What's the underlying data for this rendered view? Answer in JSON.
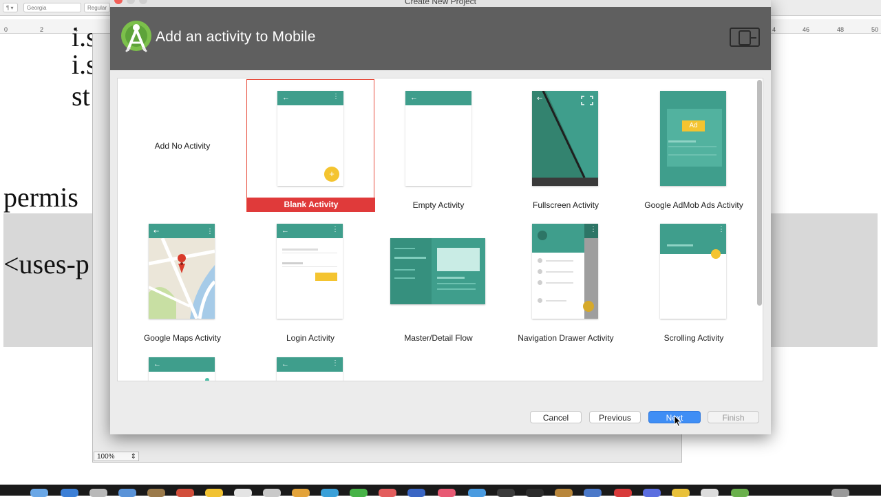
{
  "window_title": "Create New Project",
  "header": {
    "title": "Add an activity to Mobile"
  },
  "activities": [
    {
      "label": "Add No Activity"
    },
    {
      "label": "Blank Activity",
      "selected": true
    },
    {
      "label": "Empty Activity"
    },
    {
      "label": "Fullscreen Activity"
    },
    {
      "label": "Google AdMob Ads Activity"
    },
    {
      "label": "Google Maps Activity"
    },
    {
      "label": "Login Activity"
    },
    {
      "label": "Master/Detail Flow"
    },
    {
      "label": "Navigation Drawer Activity"
    },
    {
      "label": "Scrolling Activity"
    }
  ],
  "ad_badge": "Ad",
  "buttons": {
    "cancel": "Cancel",
    "previous": "Previous",
    "next": "Next",
    "finish": "Finish"
  },
  "background_app": {
    "font_combo": "Georgia",
    "style_combo": "Regular",
    "zoom": "100%",
    "doc_fragments": [
      "i.s",
      "i.s",
      "st",
      "permis",
      "<uses-p"
    ],
    "ruler_numbers_left": [
      "0",
      "2",
      "4"
    ],
    "ruler_numbers_right": [
      "4",
      "46",
      "48",
      "50"
    ]
  },
  "colors": {
    "teal": "#3f9e8c",
    "selection_red": "#e03a3a",
    "primary_blue": "#3f8ef5",
    "header_gray": "#5f5f5f"
  }
}
